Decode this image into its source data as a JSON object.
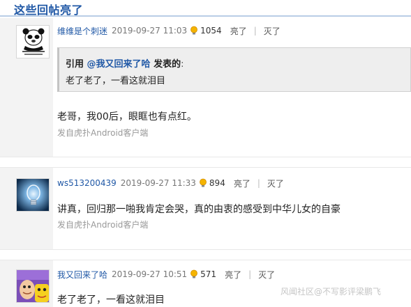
{
  "section": {
    "title": "这些回帖亮了"
  },
  "posts": [
    {
      "username": "维维是个刺迷",
      "timestamp": "2019-09-27 11:03",
      "light_count": "1054",
      "light_label": "亮了",
      "dim_label": "灭了",
      "divider": "|",
      "quote": {
        "prefix": "引用",
        "user": "@我又回来了哈",
        "suffix": "发表的",
        "colon": ":",
        "text": "老了老了，一看这就泪目"
      },
      "body": "老哥，我00后，眼眶也有点红。",
      "source": "发自虎扑Android客户端"
    },
    {
      "username": "ws513200439",
      "timestamp": "2019-09-27 11:33",
      "light_count": "894",
      "light_label": "亮了",
      "dim_label": "灭了",
      "divider": "|",
      "body": "讲真，回归那一啪我肯定会哭，真的由衷的感受到中华儿女的自豪",
      "source": "发自虎扑Android客户端"
    },
    {
      "username": "我又回来了哈",
      "timestamp": "2019-09-27 10:51",
      "light_count": "571",
      "light_label": "亮了",
      "dim_label": "灭了",
      "divider": "|",
      "body": "老了老了，一看这就泪目"
    }
  ],
  "watermark": "风闻社区@不写影评梁鹏飞",
  "colors": {
    "link": "#2058a6",
    "accent_border": "#b9cde6",
    "bulb": "#f5b400"
  }
}
